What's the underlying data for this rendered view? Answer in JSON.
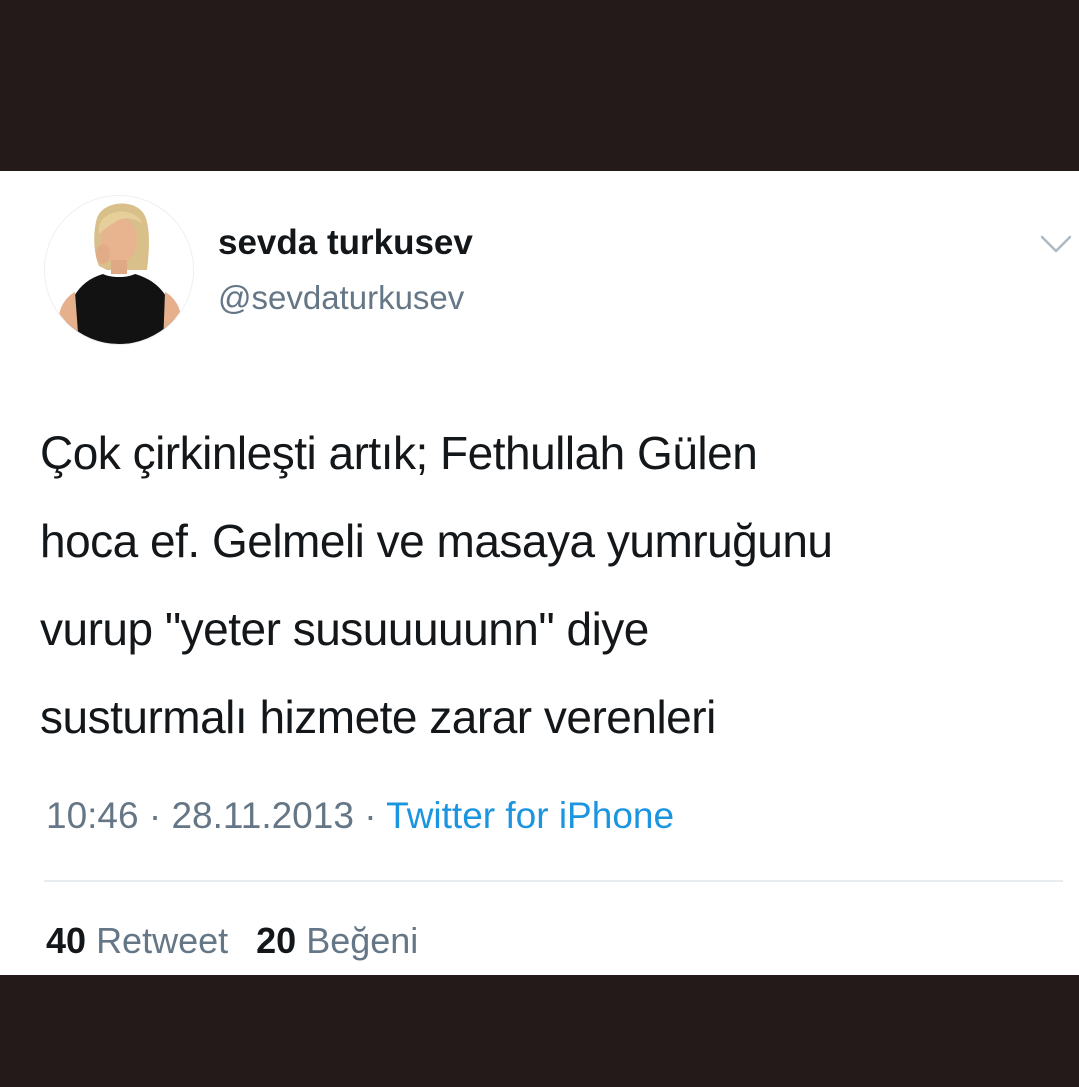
{
  "tweet": {
    "display_name": "sevda turkusev",
    "handle": "@sevdaturkusev",
    "text": "Çok çirkinleşti artık; Fethullah Gülen\nhoca ef. Gelmeli ve masaya yumruğunu\nvurup \"yeter susuuuuunn\" diye\nsusturmalı hizmete zarar verenleri",
    "time": "10:46",
    "separator": " · ",
    "date": "28.11.2013",
    "source": "Twitter for iPhone",
    "retweet_count": "40",
    "retweet_label": "Retweet",
    "like_count": "20",
    "like_label": "Beğeni"
  },
  "icons": {
    "menu": "chevron-down-icon",
    "avatar": "profile-photo"
  },
  "colors": {
    "background_band": "#241a19",
    "card": "#ffffff",
    "text_primary": "#14171a",
    "text_secondary": "#657786",
    "link": "#1b95e0",
    "divider": "#e6ecf0"
  }
}
